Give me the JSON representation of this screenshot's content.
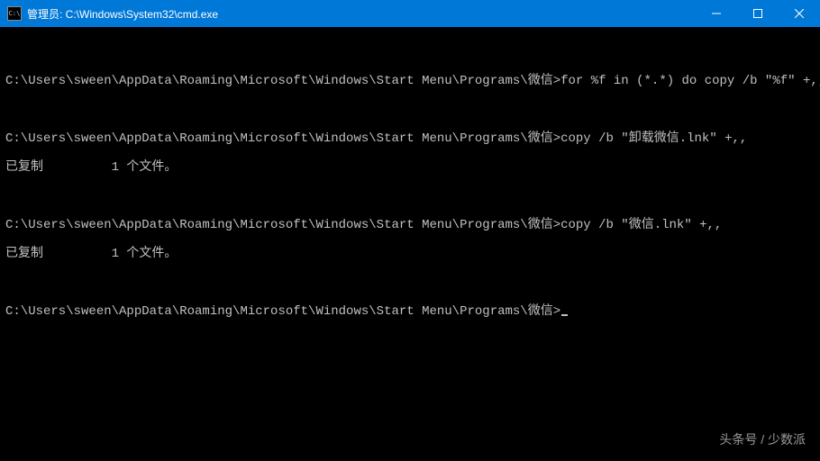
{
  "window": {
    "title": "管理员: C:\\Windows\\System32\\cmd.exe",
    "icon_label": "C:\\"
  },
  "terminal": {
    "prompt": "C:\\Users\\sween\\AppData\\Roaming\\Microsoft\\Windows\\Start Menu\\Programs\\微信>",
    "lines": {
      "l1": "C:\\Users\\sween\\AppData\\Roaming\\Microsoft\\Windows\\Start Menu\\Programs\\微信>for %f in (*.*) do copy /b \"%f\" +,,",
      "l2": "C:\\Users\\sween\\AppData\\Roaming\\Microsoft\\Windows\\Start Menu\\Programs\\微信>copy /b \"卸载微信.lnk\" +,,",
      "l3": "已复制         1 个文件。",
      "l4": "C:\\Users\\sween\\AppData\\Roaming\\Microsoft\\Windows\\Start Menu\\Programs\\微信>copy /b \"微信.lnk\" +,,",
      "l5": "已复制         1 个文件。",
      "l6": "C:\\Users\\sween\\AppData\\Roaming\\Microsoft\\Windows\\Start Menu\\Programs\\微信>"
    }
  },
  "watermark": "头条号 / 少数派"
}
